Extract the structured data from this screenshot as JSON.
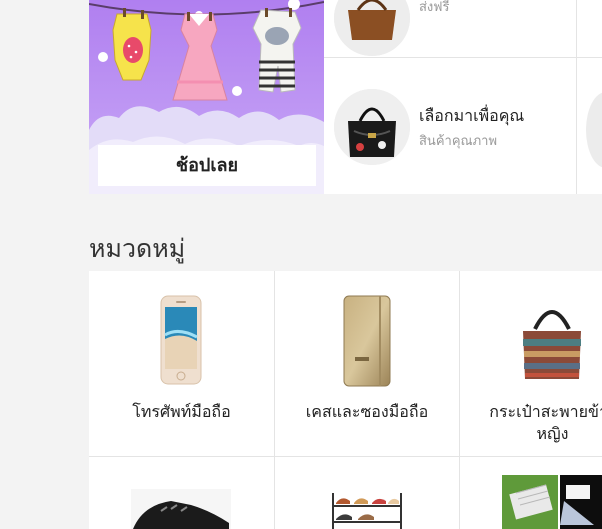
{
  "banner": {
    "shop_button": "ช้อปเลย"
  },
  "recommend": {
    "items": [
      {
        "title": "",
        "subtitle": "ส่งฟรี",
        "icon": "brown-handbag-image"
      },
      {
        "title": "เลือกมาเพื่อคุณ",
        "subtitle": "สินค้าคุณภาพ",
        "icon": "black-handbag-image"
      }
    ]
  },
  "categories": {
    "heading": "หมวดหมู่",
    "items": [
      {
        "label": "โทรศัพท์มือถือ",
        "icon": "smartphone-image"
      },
      {
        "label": "เคสและซองมือถือ",
        "icon": "phone-case-image"
      },
      {
        "label": "กระเป๋าสะพายข้าง\nหญิง",
        "icon": "shoulder-bag-image"
      },
      {
        "label": "",
        "icon": "sneakers-image"
      },
      {
        "label": "",
        "icon": "shoe-rack-image"
      },
      {
        "label": "",
        "icon": "solar-light-image"
      }
    ]
  }
}
